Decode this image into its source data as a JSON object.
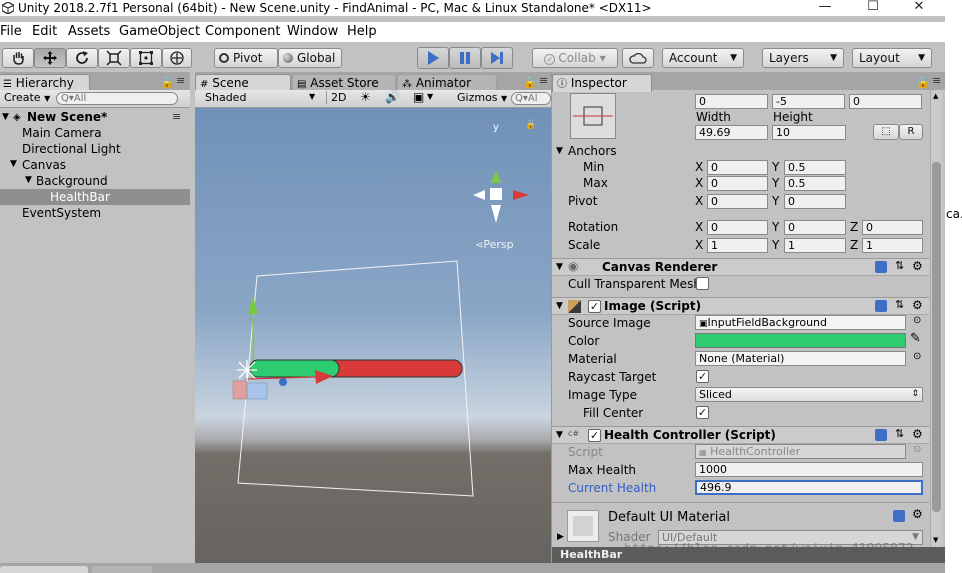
{
  "window": {
    "title": "Unity 2018.2.7f1 Personal (64bit) - New Scene.unity - FindAnimal - PC, Mac & Linux Standalone* <DX11>",
    "minimize": "—",
    "maximize": "☐",
    "close": "✕"
  },
  "menu": [
    "File",
    "Edit",
    "Assets",
    "GameObject",
    "Component",
    "Window",
    "Help"
  ],
  "toolbar": {
    "pivot": "Pivot",
    "global": "Global",
    "collab": "Collab ▾",
    "account": "Account",
    "layers": "Layers",
    "layout": "Layout"
  },
  "hierarchy": {
    "tab": "Hierarchy",
    "create": "Create",
    "search_placeholder": "Q▾All",
    "scene": "New Scene*",
    "items": [
      "Main Camera",
      "Directional Light",
      "Canvas",
      "Background",
      "HealthBar",
      "EventSystem"
    ]
  },
  "scene": {
    "tabs": [
      "Scene",
      "Asset Store",
      "Animator"
    ],
    "shading": "Shaded",
    "mode2d": "2D",
    "gizmos": "Gizmos",
    "search_placeholder": "Q▾Al",
    "persp": "Persp"
  },
  "inspector": {
    "tab": "Inspector",
    "rect": {
      "pos_x": "0",
      "pos_y": "-5",
      "pos_z": "0",
      "width_label": "Width",
      "height_label": "Height",
      "width": "49.69",
      "height": "10",
      "r_button": "R"
    },
    "anchors": {
      "label": "Anchors",
      "min_label": "Min",
      "min_x": "0",
      "min_y": "0.5",
      "max_label": "Max",
      "max_x": "0",
      "max_y": "0.5"
    },
    "pivot": {
      "label": "Pivot",
      "x": "0",
      "y": "0"
    },
    "rotation": {
      "label": "Rotation",
      "x": "0",
      "y": "0",
      "z": "0"
    },
    "scale": {
      "label": "Scale",
      "x": "1",
      "y": "1",
      "z": "1"
    },
    "axis_x": "X",
    "axis_y": "Y",
    "axis_z": "Z",
    "canvas_renderer": {
      "title": "Canvas Renderer",
      "cull_label": "Cull Transparent Mesh"
    },
    "image": {
      "title": "Image (Script)",
      "source_label": "Source Image",
      "source_value": "InputFieldBackground",
      "color_label": "Color",
      "color": "#2ecc71",
      "material_label": "Material",
      "material_value": "None (Material)",
      "raycast_label": "Raycast Target",
      "type_label": "Image Type",
      "type_value": "Sliced",
      "fill_label": "Fill Center"
    },
    "health": {
      "title": "Health Controller (Script)",
      "script_label": "Script",
      "script_value": "HealthController",
      "max_label": "Max Health",
      "max_value": "1000",
      "current_label": "Current Health",
      "current_value": "496.9"
    },
    "material": {
      "title": "Default UI Material",
      "shader_label": "Shader",
      "shader_value": "UI/Default"
    },
    "footer": "HealthBar"
  },
  "watermark": "https://blog.csdn.net/weixin_41995872",
  "cut_text": "ca.",
  "healthbar_fill": 0.42,
  "colors": {
    "accent_blue": "#3d6ec8",
    "health_green": "#2ecc71",
    "health_red": "#d83a3a",
    "sky_top": "#6d8fb7",
    "ground": "#6b6660"
  }
}
